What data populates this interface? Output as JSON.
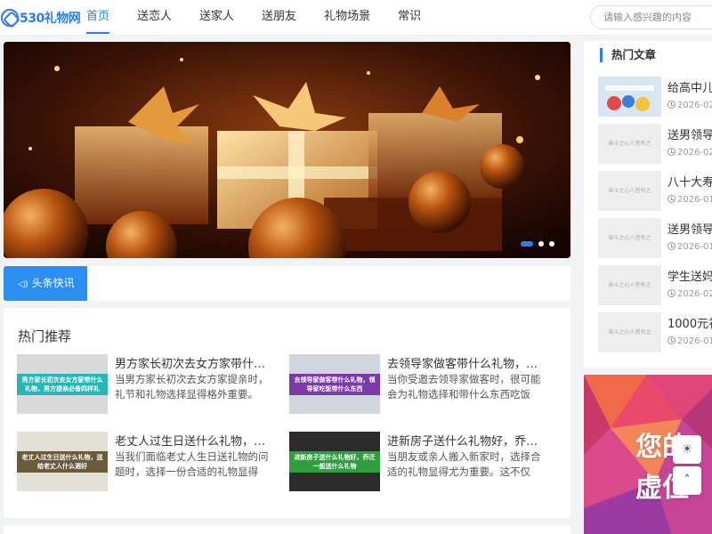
{
  "header": {
    "logo_text": "530礼物网",
    "nav": [
      "首页",
      "送恋人",
      "送家人",
      "送朋友",
      "礼物场景",
      "常识"
    ],
    "active_nav": "首页",
    "search_placeholder": "请输入感兴趣的内容"
  },
  "banner": {
    "slide_count": 3,
    "active_slide": 1
  },
  "headline": {
    "label": "头条快讯",
    "icon": "speaker-icon"
  },
  "recommend": {
    "title": "热门推荐",
    "items": [
      {
        "title": "男方家长初次去女方家带什么...",
        "desc": "当男方家长初次去女方家提亲时，礼节和礼物选择显得格外重要。这...",
        "thumb_text": "男方家长初次去女方家带什么礼物，男方提亲必备四样礼"
      },
      {
        "title": "去领导家做客带什么礼物，领...",
        "desc": "当你受邀去领导家做客时，很可能会为礼物选择和带什么东西吃饭而...",
        "thumb_text": "去领导家做客带什么礼物，领导家吃饭带什么东西"
      },
      {
        "title": "老丈人过生日送什么礼物，送...",
        "desc": "当我们面临老丈人生日送礼物的问题时，选择一份合适的礼物显得格...",
        "thumb_text": "老丈人过生日送什么礼物，送给老丈人什么酒好"
      },
      {
        "title": "进新房子送什么礼物好，乔迁...",
        "desc": "当朋友或亲人搬入新家时，选择合适的礼物显得尤为重要。这不仅是...",
        "thumb_text": "进新房子送什么礼物好，乔迁一般送什么礼物"
      }
    ]
  },
  "hot": {
    "title": "热门文章",
    "items": [
      {
        "name": "给高中儿",
        "date": "2026-02-"
      },
      {
        "name": "送男领导",
        "date": "2026-02-"
      },
      {
        "name": "八十大寿",
        "date": "2026-01-"
      },
      {
        "name": "送男领导",
        "date": "2026-01-"
      },
      {
        "name": "学生送妈",
        "date": "2026-02-"
      },
      {
        "name": "1000元礼",
        "date": "2026-01-"
      }
    ],
    "placeholder_text": "奋斗之心人皆有之"
  },
  "ad": {
    "line1": "您的",
    "line2": "虚位"
  },
  "colors": {
    "accent": "#2b7de9",
    "headline_tag": "#2b8ef0"
  }
}
